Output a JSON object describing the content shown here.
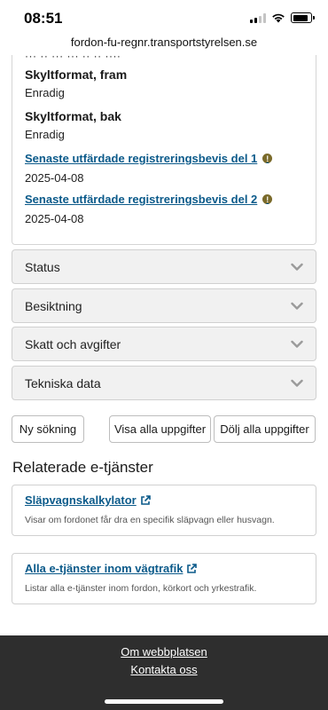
{
  "status_bar": {
    "time": "08:51"
  },
  "browser": {
    "url": "fordon-fu-regnr.transportstyrelsen.se"
  },
  "vehicle_info": {
    "cut_off_text": "··· ·· ··· ··· ·· ·· ····",
    "fields": [
      {
        "label": "Skyltformat, fram",
        "value": "Enradig"
      },
      {
        "label": "Skyltformat, bak",
        "value": "Enradig"
      }
    ],
    "link_fields": [
      {
        "label": "Senaste utfärdade registreringsbevis del 1",
        "value": "2025-04-08",
        "info_glyph": "!"
      },
      {
        "label": "Senaste utfärdade registreringsbevis del 2",
        "value": "2025-04-08",
        "info_glyph": "!"
      }
    ]
  },
  "accordions": [
    {
      "label": "Status"
    },
    {
      "label": "Besiktning"
    },
    {
      "label": "Skatt och avgifter"
    },
    {
      "label": "Tekniska data"
    }
  ],
  "actions": {
    "new_search": "Ny sökning",
    "show_all": "Visa alla uppgifter",
    "hide_all": "Dölj alla uppgifter"
  },
  "related": {
    "title": "Relaterade e-tjänster",
    "services": [
      {
        "title": "Släpvagnskalkylator",
        "description": "Visar om fordonet får dra en specifik släpvagn eller husvagn."
      },
      {
        "title": "Alla e-tjänster inom vägtrafik",
        "description": "Listar alla e-tjänster inom fordon, körkort och yrkestrafik."
      }
    ]
  },
  "footer": {
    "about": "Om webbplatsen",
    "contact": "Kontakta oss"
  },
  "colors": {
    "link": "#0b5a8a",
    "info_dot": "#7a6a2a",
    "accordion_bg": "#f1f1f1",
    "footer_bg": "#2e2e2e"
  },
  "icons": {
    "info": "info-circle-icon",
    "chevron": "chevron-down-icon",
    "external": "external-link-icon"
  }
}
